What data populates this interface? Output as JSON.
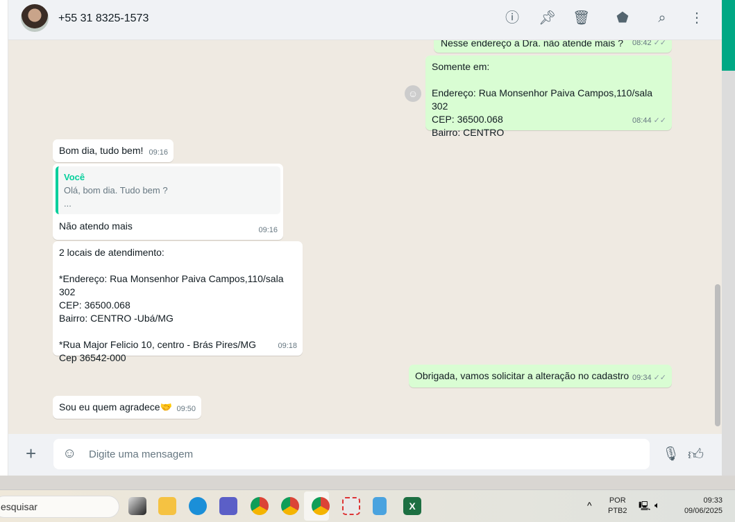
{
  "header": {
    "contact": "+55 31 8325-1573",
    "icons": [
      "info-icon",
      "pin-icon",
      "trash-icon",
      "label-icon",
      "search-icon",
      "menu-icon"
    ]
  },
  "messages": [
    {
      "dir": "out",
      "text": "Nesse endereço a Dra. não atende mais ?",
      "time": "08:42"
    },
    {
      "dir": "out",
      "lines": [
        "Somente em:",
        "",
        "Endereço: Rua Monsenhor Paiva Campos,110/sala 302",
        "CEP: 36500.068",
        "Bairro: CENTRO"
      ],
      "time": "08:44"
    },
    {
      "dir": "in",
      "text": "Bom dia, tudo bem!",
      "time": "09:16"
    },
    {
      "dir": "in",
      "quote_name": "Você",
      "quote_lines": [
        "Olá, bom dia. Tudo bem ?",
        "..."
      ],
      "text": "Não atendo mais",
      "time": "09:16"
    },
    {
      "dir": "in",
      "lines": [
        "2 locais de atendimento:",
        "",
        "*Endereço: Rua Monsenhor Paiva Campos,110/sala 302",
        "CEP: 36500.068",
        "Bairro: CENTRO -Ubá/MG",
        "",
        "*Rua Major Felicio 10, centro - Brás Pires/MG",
        "Cep 36542-000"
      ],
      "time": "09:18"
    },
    {
      "dir": "out",
      "text": "Obrigada, vamos solicitar a alteração no cadastro",
      "time": "09:34"
    },
    {
      "dir": "in",
      "text": "Sou eu quem agradece🤝",
      "time": "09:50"
    }
  ],
  "footer": {
    "placeholder": "Digite uma mensagem"
  },
  "taskbar": {
    "search": "esquisar",
    "lang1": "POR",
    "lang2": "PTB2",
    "time": "09:33",
    "date": "09/06/2025"
  }
}
